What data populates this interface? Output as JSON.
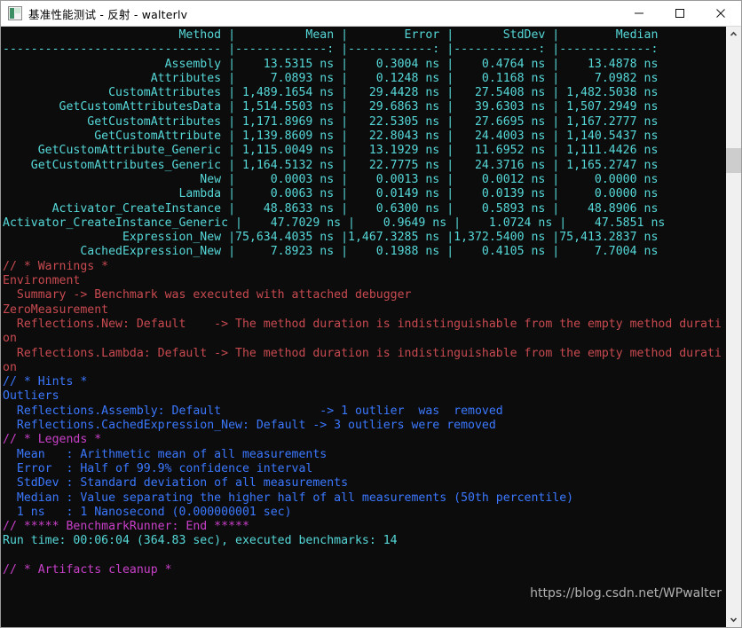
{
  "window": {
    "title": "基准性能测试 - 反射 - walterlv",
    "icon": "console-icon",
    "controls": {
      "minimize": "minimize-button",
      "maximize": "maximize-button",
      "close": "close-button"
    }
  },
  "colors": {
    "background": "#0c0c0c",
    "cyan": "#56d8d8",
    "blue": "#3b78ff",
    "red": "#c84a50",
    "magenta": "#c840c8",
    "titlebar": "#ffffff",
    "scrollbar_track": "#f0f0f0",
    "scrollbar_thumb": "#cdcdcd"
  },
  "table": {
    "headers": [
      "Method",
      "Mean",
      "Error",
      "StdDev",
      "Median"
    ],
    "separator": [
      "--------------------------",
      "-------------:",
      "-------------:",
      "-------------:",
      "-------------:"
    ],
    "rows": [
      {
        "method": "Assembly",
        "mean": "13.5315 ns",
        "error": "0.3004 ns",
        "stddev": "0.4764 ns",
        "median": "13.4878 ns"
      },
      {
        "method": "Attributes",
        "mean": "7.0893 ns",
        "error": "0.1248 ns",
        "stddev": "0.1168 ns",
        "median": "7.0982 ns"
      },
      {
        "method": "CustomAttributes",
        "mean": "1,489.1654 ns",
        "error": "29.4428 ns",
        "stddev": "27.5408 ns",
        "median": "1,482.5038 ns"
      },
      {
        "method": "GetCustomAttributesData",
        "mean": "1,514.5503 ns",
        "error": "29.6863 ns",
        "stddev": "39.6303 ns",
        "median": "1,507.2949 ns"
      },
      {
        "method": "GetCustomAttributes",
        "mean": "1,171.8969 ns",
        "error": "22.5305 ns",
        "stddev": "27.6695 ns",
        "median": "1,167.2777 ns"
      },
      {
        "method": "GetCustomAttribute",
        "mean": "1,139.8609 ns",
        "error": "22.8043 ns",
        "stddev": "24.4003 ns",
        "median": "1,140.5437 ns"
      },
      {
        "method": "GetCustomAttribute_Generic",
        "mean": "1,115.0049 ns",
        "error": "13.1929 ns",
        "stddev": "11.6952 ns",
        "median": "1,111.4426 ns"
      },
      {
        "method": "GetCustomAttributes_Generic",
        "mean": "1,164.5132 ns",
        "error": "22.7775 ns",
        "stddev": "24.3716 ns",
        "median": "1,165.2747 ns"
      },
      {
        "method": "New",
        "mean": "0.0003 ns",
        "error": "0.0013 ns",
        "stddev": "0.0012 ns",
        "median": "0.0000 ns"
      },
      {
        "method": "Lambda",
        "mean": "0.0063 ns",
        "error": "0.0149 ns",
        "stddev": "0.0139 ns",
        "median": "0.0000 ns"
      },
      {
        "method": "Activator_CreateInstance",
        "mean": "48.8633 ns",
        "error": "0.6300 ns",
        "stddev": "0.5893 ns",
        "median": "48.8906 ns"
      },
      {
        "method": "Activator_CreateInstance_Generic",
        "mean": "47.7029 ns",
        "error": "0.9649 ns",
        "stddev": "1.0724 ns",
        "median": "47.5851 ns"
      },
      {
        "method": "Expression_New",
        "mean": "75,634.4035 ns",
        "error": "1,467.3285 ns",
        "stddev": "1,372.5400 ns",
        "median": "75,413.2837 ns"
      },
      {
        "method": "CachedExpression_New",
        "mean": "7.8923 ns",
        "error": "0.1988 ns",
        "stddev": "0.4105 ns",
        "median": "7.7004 ns"
      }
    ]
  },
  "warnings": {
    "header": "// * Warnings *",
    "lines": [
      "Environment",
      "  Summary -> Benchmark was executed with attached debugger",
      "ZeroMeasurement",
      "  Reflections.New: Default    -> The method duration is indistinguishable from the empty method durati",
      "on",
      "  Reflections.Lambda: Default -> The method duration is indistinguishable from the empty method durati",
      "on"
    ]
  },
  "hints": {
    "header": "// * Hints *",
    "lines": [
      "Outliers",
      "  Reflections.Assembly: Default              -> 1 outlier  was  removed",
      "  Reflections.CachedExpression_New: Default -> 3 outliers were removed"
    ]
  },
  "legends": {
    "header": "// * Legends *",
    "lines": [
      "  Mean   : Arithmetic mean of all measurements",
      "  Error  : Half of 99.9% confidence interval",
      "  StdDev : Standard deviation of all measurements",
      "  Median : Value separating the higher half of all measurements (50th percentile)",
      "  1 ns   : 1 Nanosecond (0.000000001 sec)"
    ]
  },
  "footer": {
    "end_header": "// ***** BenchmarkRunner: End *****",
    "run_time": "Run time: 00:06:04 (364.83 sec), executed benchmarks: 14",
    "artifacts": "// * Artifacts cleanup *"
  },
  "watermark": "https://blog.csdn.net/WPwalter",
  "scrollbar": {
    "up_arrow": "chevron-up-icon",
    "down_arrow": "chevron-down-icon"
  }
}
